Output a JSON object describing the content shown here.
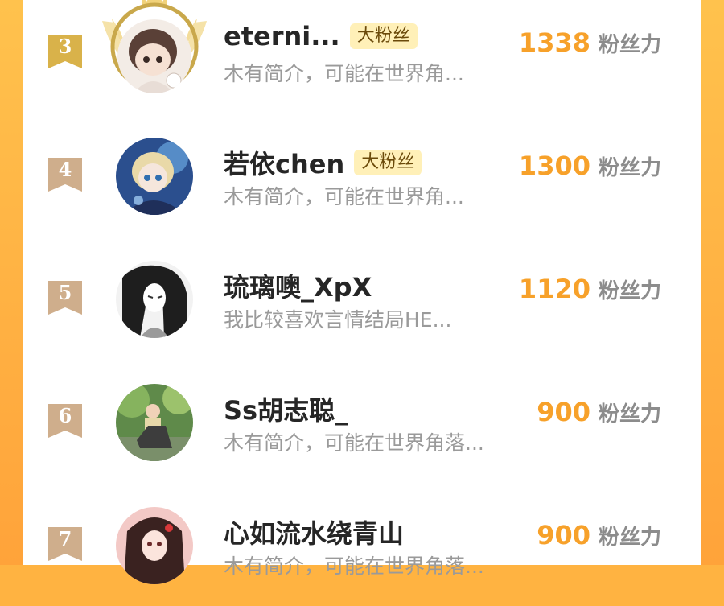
{
  "ranking": {
    "rows": [
      {
        "rank": "3",
        "name": "eterni...",
        "badge": "大粉丝",
        "bio": "木有简介，可能在世界角...",
        "score": "1338",
        "unit": "粉丝力"
      },
      {
        "rank": "4",
        "name": "若依chen",
        "badge": "大粉丝",
        "bio": "木有简介，可能在世界角...",
        "score": "1300",
        "unit": "粉丝力"
      },
      {
        "rank": "5",
        "name": "琉璃噢_XpX",
        "badge": "",
        "bio": "我比较喜欢言情结局HE...",
        "score": "1120",
        "unit": "粉丝力"
      },
      {
        "rank": "6",
        "name": "Ss胡志聪_",
        "badge": "",
        "bio": "木有简介，可能在世界角落...",
        "score": "900",
        "unit": "粉丝力"
      },
      {
        "rank": "7",
        "name": "心如流水绕青山",
        "badge": "",
        "bio": "木有简介，可能在世界角落...",
        "score": "900",
        "unit": "粉丝力"
      }
    ]
  },
  "colors": {
    "score": "#f7a12a",
    "badge_bg": "#fff0b8",
    "rank3_ribbon": "#d9b24a",
    "rank_ribbon": "#cfae8c",
    "frame": "#ffb341"
  },
  "icons": {
    "rank_marker": "ribbon-icon",
    "top_avatar_ornament": "laurel-crown-icon"
  }
}
